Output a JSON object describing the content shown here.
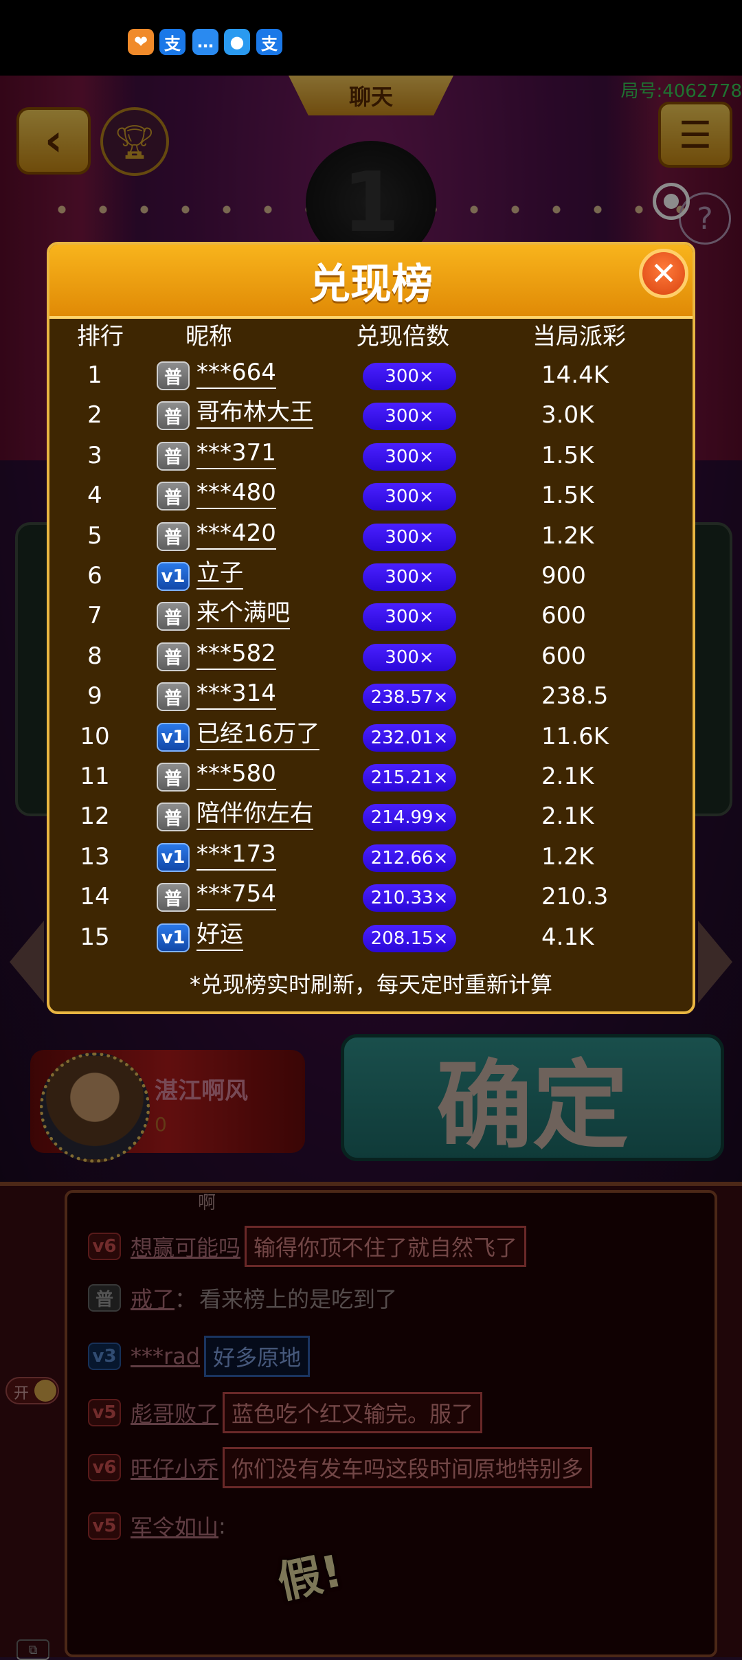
{
  "status_bar": {
    "icons": [
      {
        "name": "heart-app-icon",
        "glyph": "❤",
        "color": "#f08a2a"
      },
      {
        "name": "alipay-icon",
        "glyph": "支",
        "color": "#1a78e8"
      },
      {
        "name": "message-icon",
        "glyph": "…",
        "color": "#2a8af0"
      },
      {
        "name": "weather-icon",
        "glyph": "●",
        "color": "#2a9af0"
      },
      {
        "name": "alipay-icon-2",
        "glyph": "支",
        "color": "#1a78e8"
      }
    ]
  },
  "game": {
    "chat_tab": "聊天",
    "round_id": "局号:4062778",
    "player_name": "湛江啊风",
    "player_score": "0",
    "confirm_label": "确定"
  },
  "leaderboard": {
    "title": "兑现榜",
    "close_glyph": "✕",
    "headers": {
      "rank": "排行",
      "nickname": "昵称",
      "multiplier": "兑现倍数",
      "payout": "当局派彩"
    },
    "rows": [
      {
        "rank": "1",
        "badge": "普",
        "name": "***664",
        "mult": "300×",
        "payout": "14.4K"
      },
      {
        "rank": "2",
        "badge": "普",
        "name": "哥布林大王",
        "mult": "300×",
        "payout": "3.0K"
      },
      {
        "rank": "3",
        "badge": "普",
        "name": "***371",
        "mult": "300×",
        "payout": "1.5K"
      },
      {
        "rank": "4",
        "badge": "普",
        "name": "***480",
        "mult": "300×",
        "payout": "1.5K"
      },
      {
        "rank": "5",
        "badge": "普",
        "name": "***420",
        "mult": "300×",
        "payout": "1.2K"
      },
      {
        "rank": "6",
        "badge": "v1",
        "name": "立子",
        "mult": "300×",
        "payout": "900"
      },
      {
        "rank": "7",
        "badge": "普",
        "name": "来个满吧",
        "mult": "300×",
        "payout": "600"
      },
      {
        "rank": "8",
        "badge": "普",
        "name": "***582",
        "mult": "300×",
        "payout": "600"
      },
      {
        "rank": "9",
        "badge": "普",
        "name": "***314",
        "mult": "238.57×",
        "payout": "238.5"
      },
      {
        "rank": "10",
        "badge": "v1",
        "name": "已经16万了",
        "mult": "232.01×",
        "payout": "11.6K"
      },
      {
        "rank": "11",
        "badge": "普",
        "name": "***580",
        "mult": "215.21×",
        "payout": "2.1K"
      },
      {
        "rank": "12",
        "badge": "普",
        "name": "陪伴你左右",
        "mult": "214.99×",
        "payout": "2.1K"
      },
      {
        "rank": "13",
        "badge": "v1",
        "name": "***173",
        "mult": "212.66×",
        "payout": "1.2K"
      },
      {
        "rank": "14",
        "badge": "普",
        "name": "***754",
        "mult": "210.33×",
        "payout": "210.3"
      },
      {
        "rank": "15",
        "badge": "v1",
        "name": "好运",
        "mult": "208.15×",
        "payout": "4.1K"
      }
    ],
    "footnote": "*兑现榜实时刷新，每天定时重新计算"
  },
  "chat": {
    "top_text": "啊",
    "toggle_label": "开",
    "messages": [
      {
        "badge": "v6",
        "style": "red",
        "name": "想赢可能吗",
        "text": "输得你顶不住了就自然飞了"
      },
      {
        "badge": "普",
        "style": "gray",
        "name": "戒了",
        "text": "看来榜上的是吃到了"
      },
      {
        "badge": "v3",
        "style": "blue",
        "name": "***rad",
        "text": "好多原地"
      },
      {
        "badge": "v5",
        "style": "red",
        "name": "彪哥败了",
        "text": "蓝色吃个红又输完。服了"
      },
      {
        "badge": "v6",
        "style": "red",
        "name": "旺仔小乔",
        "text": "你们没有发车吗这段时间原地特别多"
      },
      {
        "badge": "v5",
        "style": "red",
        "name": "军令如山",
        "text": ""
      }
    ],
    "sticker_text": "假!"
  }
}
